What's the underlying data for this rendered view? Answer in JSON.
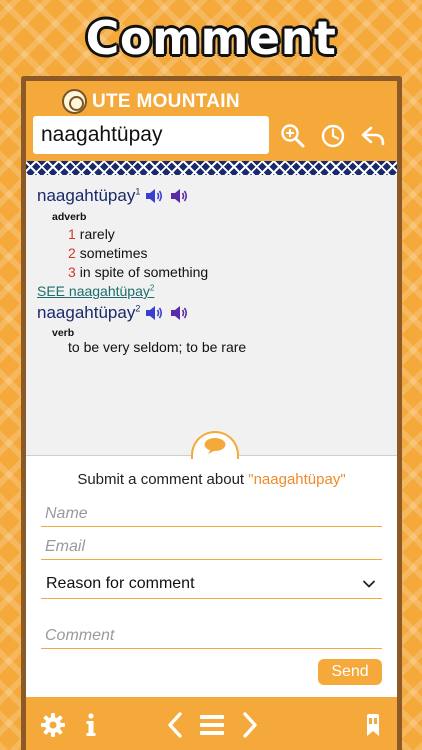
{
  "banner": {
    "title": "Comment"
  },
  "header": {
    "app_title": "UTE MOUNTAIN",
    "search_value": "naagahtüpay",
    "icons": [
      "zoom-in-icon",
      "history-icon",
      "back-icon"
    ]
  },
  "entry": {
    "headword": "naagahtüpay",
    "headword_sup": "1",
    "part_of_speech": "adverb",
    "senses": [
      {
        "num": "1",
        "text": "rarely"
      },
      {
        "num": "2",
        "text": "sometimes"
      },
      {
        "num": "3",
        "text": "in spite of something"
      }
    ],
    "see_prefix": "SEE",
    "see_word": "naagahtüpay",
    "see_sup": "2",
    "headword2": "naagahtüpay",
    "headword2_sup": "2",
    "part_of_speech2": "verb",
    "definition2": "to be very seldom; to be rare"
  },
  "comment": {
    "title_prefix": "Submit a comment about ",
    "title_word": "\"naagahtüpay\"",
    "name_placeholder": "Name",
    "email_placeholder": "Email",
    "reason_label": "Reason for comment",
    "comment_placeholder": "Comment",
    "send_label": "Send"
  },
  "footer": {
    "icons": [
      "gear-icon",
      "info-icon",
      "chevron-left-icon",
      "menu-icon",
      "chevron-right-icon",
      "bookmark-icon"
    ]
  },
  "colors": {
    "accent": "#f4a93a",
    "headword": "#1a2a6c",
    "sense_number": "#d23a2a",
    "link": "#1c6e6b",
    "comment_word": "#f08a2a",
    "frame": "#8c5a26"
  }
}
